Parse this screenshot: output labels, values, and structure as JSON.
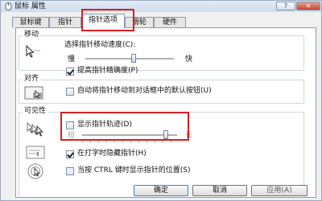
{
  "window": {
    "title": "鼠标 属性",
    "help_label": "?",
    "close_label": "✕"
  },
  "tabs": [
    {
      "label": "鼠标键"
    },
    {
      "label": "指针"
    },
    {
      "label": "指针选项"
    },
    {
      "label": "滑轮"
    },
    {
      "label": "硬件"
    }
  ],
  "motion": {
    "title": "移动",
    "speed_label": "选择指针移动速度(C):",
    "slow_label": "慢",
    "fast_label": "快",
    "speed_level": 0.55,
    "precision_label": "提高指针精确度(P)",
    "precision_checked": true
  },
  "snap": {
    "title": "对齐",
    "label": "自动将指针移动到对话框中的默认按钮(U)",
    "checked": false
  },
  "visibility": {
    "title": "可见性",
    "trails_label": "显示指针轨迹(D)",
    "trails_checked": false,
    "short_label": "短",
    "long_label": "长",
    "trails_level": 0.9,
    "hide_typing_label": "在打字时隐藏指针(H)",
    "hide_typing_checked": true,
    "ctrl_label": "当按 CTRL 键时显示指针的位置(S)",
    "ctrl_checked": false
  },
  "buttons": {
    "ok": "确定",
    "cancel": "取消",
    "apply": "应用(A)"
  },
  "colors": {
    "highlight": "#d81f1f",
    "tab_border": "#8a9ab0"
  }
}
